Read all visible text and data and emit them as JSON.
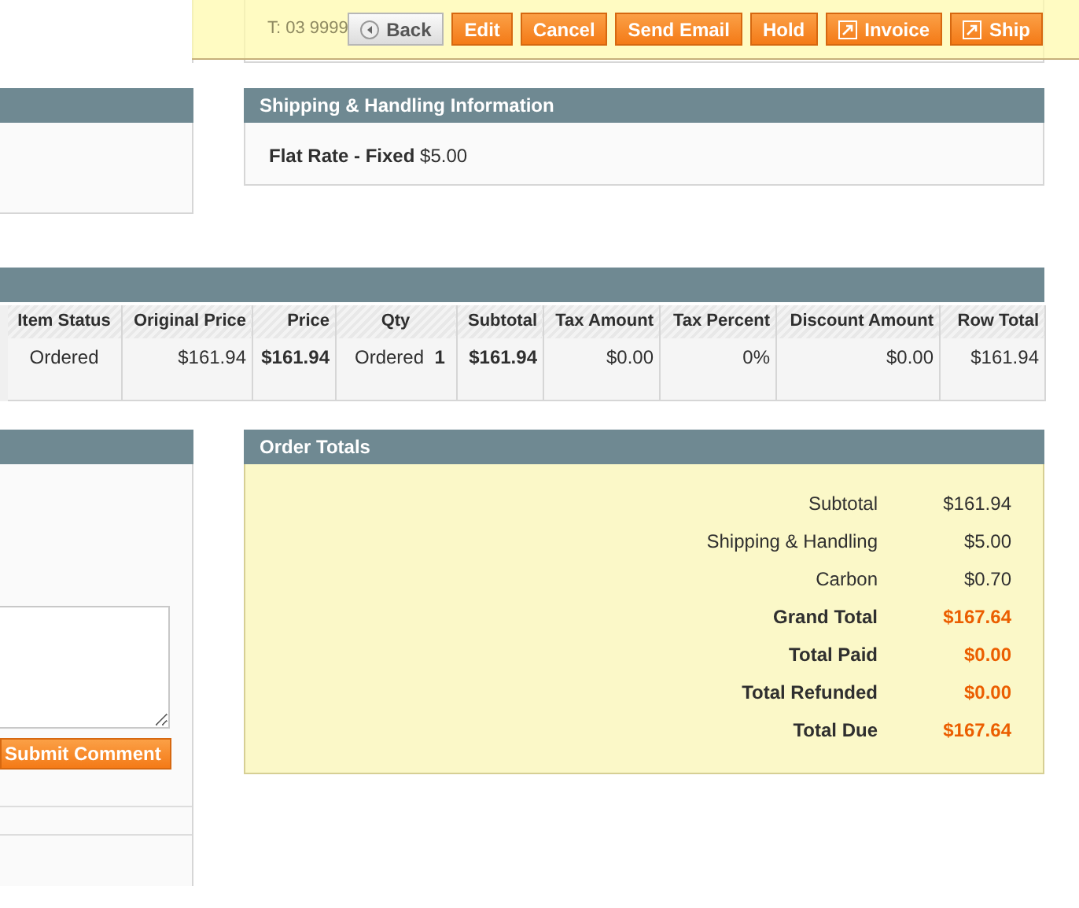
{
  "address": {
    "phone": "T: 03 9999"
  },
  "toolbar": {
    "buttons": [
      {
        "label": "Back",
        "kind": "back"
      },
      {
        "label": "Edit",
        "kind": "action"
      },
      {
        "label": "Cancel",
        "kind": "action"
      },
      {
        "label": "Send Email",
        "kind": "action"
      },
      {
        "label": "Hold",
        "kind": "action"
      },
      {
        "label": "Invoice",
        "kind": "icon-action"
      },
      {
        "label": "Ship",
        "kind": "icon-action"
      }
    ]
  },
  "shipping": {
    "title": "Shipping & Handling Information",
    "method": "Flat Rate - Fixed",
    "price": "$5.00"
  },
  "items": {
    "columns": [
      {
        "label": "Item Status",
        "kind": "status",
        "bold": false
      },
      {
        "label": "Original Price",
        "kind": "amount",
        "bold": false
      },
      {
        "label": "Price",
        "kind": "amount",
        "bold": true
      },
      {
        "label": "Qty",
        "kind": "qty",
        "bold": false
      },
      {
        "label": "Subtotal",
        "kind": "amount",
        "bold": true
      },
      {
        "label": "Tax Amount",
        "kind": "amount",
        "bold": false
      },
      {
        "label": "Tax Percent",
        "kind": "amount",
        "bold": false
      },
      {
        "label": "Discount Amount",
        "kind": "amount",
        "bold": false
      },
      {
        "label": "Row Total",
        "kind": "amount",
        "bold": false
      }
    ],
    "rows": [
      {
        "cells": [
          "Ordered",
          "$161.94",
          "$161.94",
          "Ordered  **1**",
          "$161.94",
          "$0.00",
          "0%",
          "$0.00",
          "$161.94"
        ]
      }
    ]
  },
  "comments": {
    "submit": "Submit Comment"
  },
  "totals": {
    "title": "Order Totals",
    "rows": [
      {
        "label": "Subtotal",
        "value": "$161.94",
        "emphasis": false
      },
      {
        "label": "Shipping & Handling",
        "value": "$5.00",
        "emphasis": false
      },
      {
        "label": "Carbon",
        "value": "$0.70",
        "emphasis": false
      },
      {
        "label": "Grand Total",
        "value": "$167.64",
        "emphasis": true
      },
      {
        "label": "Total Paid",
        "value": "$0.00",
        "emphasis": true
      },
      {
        "label": "Total Refunded",
        "value": "$0.00",
        "emphasis": true
      },
      {
        "label": "Total Due",
        "value": "$167.64",
        "emphasis": true
      }
    ]
  }
}
